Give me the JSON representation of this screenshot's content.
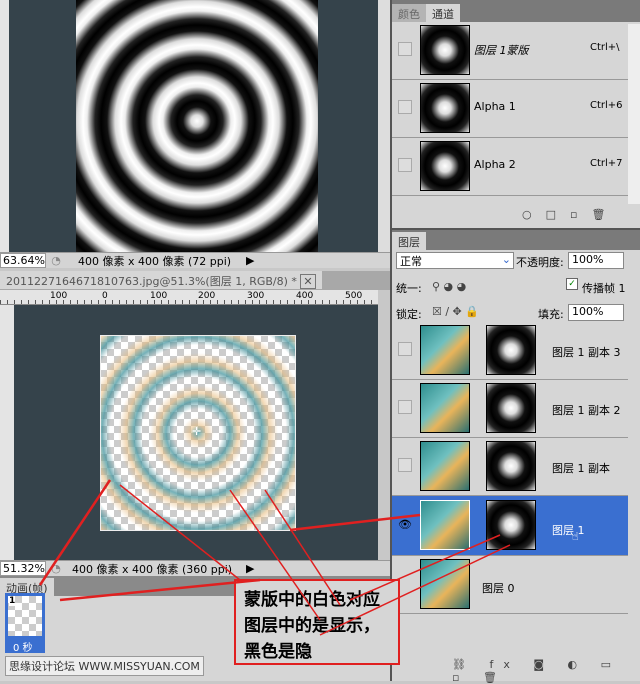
{
  "doc1": {
    "zoom": "63.64%",
    "size": "400 像素 x 400 像素 (72 ppi)"
  },
  "doc2": {
    "title": "20112271646718107​63.jpg@51.3%(图层 1, RGB/8) *",
    "zoom": "51.32%",
    "size": "400 像素 x 400 像素 (360 ppi)",
    "ruler": [
      "100",
      "0",
      "100",
      "200",
      "300",
      "400",
      "500"
    ]
  },
  "channels": {
    "tabs": [
      "颜色",
      "通道"
    ],
    "items": [
      {
        "name": "图层 1蒙版",
        "shortcut": "Ctrl+\\"
      },
      {
        "name": "Alpha 1",
        "shortcut": "Ctrl+6"
      },
      {
        "name": "Alpha 2",
        "shortcut": "Ctrl+7"
      }
    ]
  },
  "layers": {
    "tab": "图层",
    "blend_mode": "正常",
    "opacity_label": "不透明度:",
    "opacity": "100%",
    "unify_label": "统一:",
    "propagate_label": "传播帧 1",
    "lock_label": "锁定:",
    "fill_label": "填充:",
    "fill": "100%",
    "items": [
      {
        "name": "图层 1 副本 3"
      },
      {
        "name": "图层 1 副本 2"
      },
      {
        "name": "图层 1 副本"
      },
      {
        "name": "图层 1"
      },
      {
        "name": "图层 0"
      }
    ]
  },
  "animation": {
    "tab": "动画(帧)",
    "frame_number": "1",
    "frame_delay": "0 秒"
  },
  "annotation": {
    "text": "蒙版中的白色对应图层中的是显示，黑色是隐"
  },
  "watermark": "思缘设计论坛 WWW.MISSYUAN.COM",
  "colors": {
    "canvas": "#35434b",
    "selection": "#3a6fd0",
    "annotation": "#e02020"
  }
}
